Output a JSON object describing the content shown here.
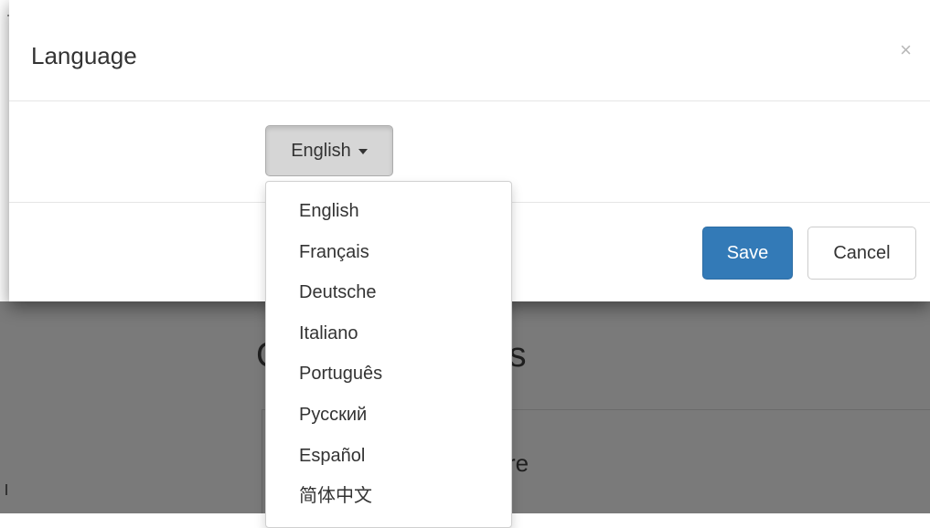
{
  "modal": {
    "title": "Language",
    "close_glyph": "×",
    "language_button_label": "English",
    "save_label": "Save",
    "cancel_label": "Cancel"
  },
  "dropdown": {
    "items": [
      {
        "label": "English"
      },
      {
        "label": "Français"
      },
      {
        "label": "Deutsche"
      },
      {
        "label": "Italiano"
      },
      {
        "label": "Português"
      },
      {
        "label": "Русский"
      },
      {
        "label": "Español"
      },
      {
        "label": "简体中文"
      }
    ]
  },
  "background": {
    "heading_fragment_left": "C",
    "heading_fragment_right": "ks",
    "sub_fragment": "re"
  },
  "colors": {
    "primary": "#337ab7",
    "backdrop": "#7a7a7a"
  }
}
